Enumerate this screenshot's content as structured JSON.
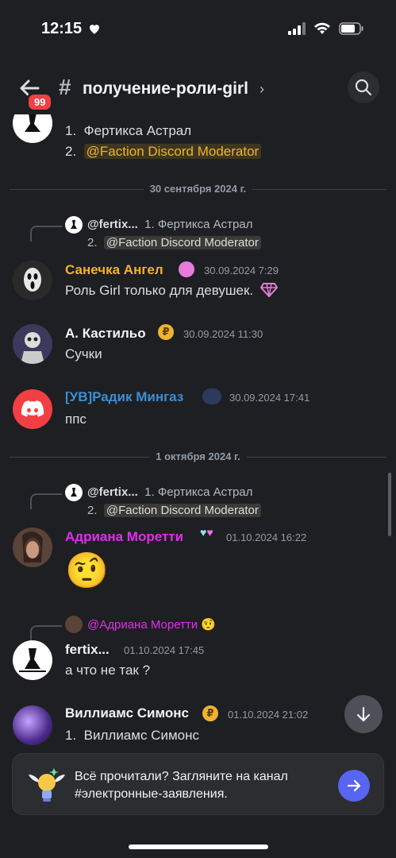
{
  "status_bar": {
    "time": "12:15"
  },
  "header": {
    "badge": "99",
    "hash": "#",
    "channel_name": "получение-роли-girl",
    "chevron": "›"
  },
  "messages": {
    "top_list": {
      "item1_num": "1.",
      "item1": "Фертикса Астрал",
      "item2_num": "2.",
      "item2": "@Faction Discord Moderator"
    },
    "divider1": "30 сентября 2024 г.",
    "reply1": {
      "name": "@fertix...",
      "text1": "1.  Фертикса Астрал",
      "text2_num": "2.",
      "text2": "@Faction Discord Moderator"
    },
    "msg1": {
      "author": "Санечка Ангел",
      "author_color": "#f0b232",
      "time": "30.09.2024 7:29",
      "text": "Роль Girl только для девушек."
    },
    "msg2": {
      "author": "А. Кастильо",
      "time": "30.09.2024 11:30",
      "text": "Сучки",
      "badge": "₽"
    },
    "msg3": {
      "author": "[УВ]Радик Мингаз",
      "author_color": "#3a8fd6",
      "time": "30.09.2024 17:41",
      "text": "ппс"
    },
    "divider2": "1 октября 2024 г.",
    "reply2": {
      "name": "@fertix...",
      "text1": "1.  Фертикса Астрал",
      "text2_num": "2.",
      "text2": "@Faction Discord Moderator"
    },
    "msg4": {
      "author": "Адриана Моретти",
      "author_color": "#e22cf0",
      "time": "01.10.2024 16:22",
      "emoji": "🤨"
    },
    "reply3": {
      "name": "@Адриана Моретти",
      "emoji": "🤨"
    },
    "msg5": {
      "author": "fertix...",
      "time": "01.10.2024 17:45",
      "text": "а что не так ?"
    },
    "msg6": {
      "author": "Виллиамс Симонс",
      "time": "01.10.2024 21:02",
      "item1_num": "1.",
      "item1": "Виллиамс Симонс",
      "badge": "₽"
    }
  },
  "banner": {
    "text": "Всё прочитали? Загляните на канал #электронные-заявления."
  },
  "icons": [
    "heart-icon",
    "signal-icon",
    "wifi-icon",
    "battery-icon",
    "back-arrow-icon",
    "search-icon",
    "arrow-down-icon",
    "arrow-right-icon",
    "discord-logo-icon",
    "gem-icon"
  ]
}
